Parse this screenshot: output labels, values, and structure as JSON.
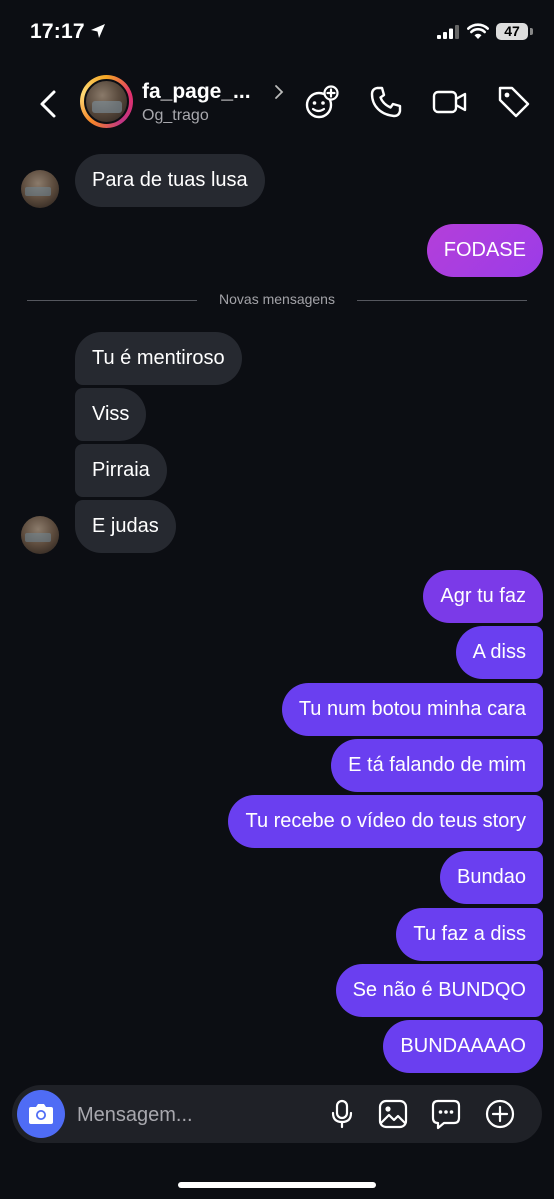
{
  "status_bar": {
    "time": "17:17",
    "battery": "47",
    "icons": [
      "location-arrow-icon",
      "signal-icon",
      "wifi-icon",
      "battery-icon"
    ]
  },
  "header": {
    "name": "fa_page_...",
    "username": "Og_trago",
    "icons": [
      "back-icon",
      "chevron-right-icon",
      "game-icon",
      "phone-icon",
      "video-icon",
      "tag-icon"
    ]
  },
  "messages": [
    {
      "text": "Para de tuas lusa",
      "side": "received"
    },
    {
      "text": "FODASE",
      "side": "sent"
    },
    {
      "text": "Tu é mentiroso",
      "side": "received"
    },
    {
      "text": "Viss",
      "side": "received"
    },
    {
      "text": "Pirraia",
      "side": "received"
    },
    {
      "text": "E judas",
      "side": "received"
    },
    {
      "text": "Agr tu faz",
      "side": "sent"
    },
    {
      "text": "A diss",
      "side": "sent"
    },
    {
      "text": "Tu num botou minha cara",
      "side": "sent"
    },
    {
      "text": "E tá falando de mim",
      "side": "sent"
    },
    {
      "text": "Tu recebe o vídeo do teus story",
      "side": "sent"
    },
    {
      "text": "Bundao",
      "side": "sent"
    },
    {
      "text": "Tu faz a diss",
      "side": "sent"
    },
    {
      "text": "Se não é BUNDQO",
      "side": "sent"
    },
    {
      "text": "BUNDAAAAO",
      "side": "sent"
    }
  ],
  "divider": {
    "label": "Novas mensagens"
  },
  "composer": {
    "placeholder": "Mensagem...",
    "icons": [
      "camera-icon",
      "microphone-icon",
      "image-icon",
      "sticker-icon",
      "plus-icon"
    ]
  },
  "colors": {
    "background": "#0c0e13",
    "received_bubble": "#262930",
    "sent_bubble": "#6a3ff0",
    "accent_camera": "#4f6cf5"
  }
}
